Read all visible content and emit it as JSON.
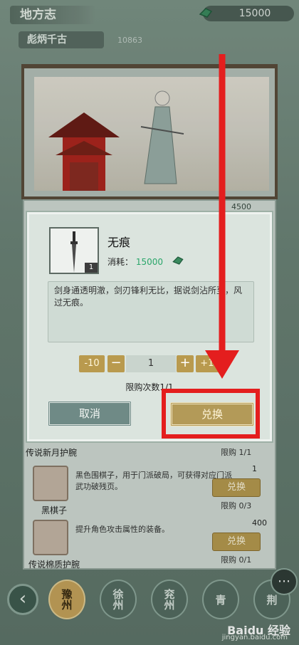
{
  "header": {
    "title": "地方志",
    "currency_value": "15000",
    "subtitle": "彪炳千古",
    "subtitle_value": "10863"
  },
  "background": {
    "partial_price": "4500"
  },
  "list": [
    {
      "name": "传说新月护腕",
      "limit": "限购 1/1"
    },
    {
      "name": "黑棋子",
      "desc": "黑色围棋子，用于门派破局，可获得对应门派武功破残页。",
      "cost": "1",
      "button": "兑换",
      "limit": "限购 0/3"
    },
    {
      "name": "传说棉质护腕",
      "desc": "提升角色攻击属性的装备。",
      "cost": "400",
      "button": "兑换",
      "limit": "限购 0/1"
    }
  ],
  "bottom_nav": {
    "back_icon": "‹",
    "regions": [
      "豫州",
      "徐州",
      "兖州",
      "青",
      "荆"
    ],
    "active_region": 0
  },
  "watermark": {
    "logo": "Baidu 经验",
    "url": "jingyan.baidu.com"
  },
  "modal": {
    "item_name": "无痕",
    "item_qty": "1",
    "cost_label": "消耗：",
    "cost_value": "15000",
    "description": "剑身通透明澈，剑刃锋利无比，据说剑沾所至，风过无痕。",
    "minus10": "-10",
    "minus": "−",
    "qty": "1",
    "plus": "+",
    "plus10": "+10",
    "limit_text": "限购次数1/1",
    "cancel": "取消",
    "exchange": "兑换"
  },
  "colors": {
    "accent_gold": "#b99a4e",
    "annotation_red": "#e41e1e",
    "cost_green": "#2aa66a"
  }
}
